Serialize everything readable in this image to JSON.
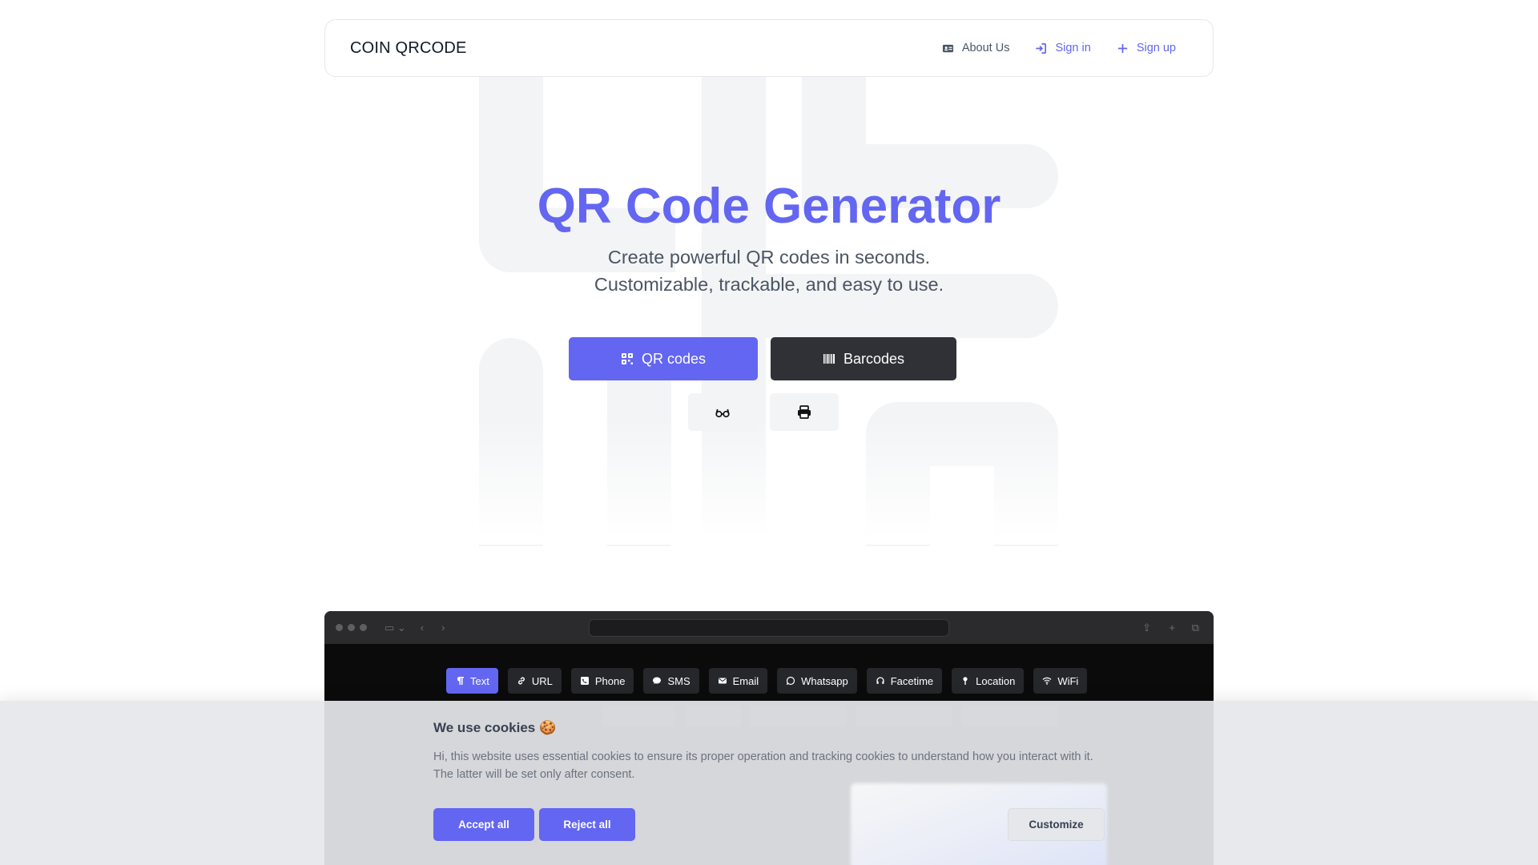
{
  "nav": {
    "brand": "COIN QRCODE",
    "about": "About Us",
    "signin": "Sign in",
    "signup": "Sign up"
  },
  "hero": {
    "title": "QR Code Generator",
    "subtitle_line1": "Create powerful QR codes in seconds.",
    "subtitle_line2": "Customizable, trackable, and easy to use.",
    "btn_qr": "QR codes",
    "btn_barcodes": "Barcodes",
    "icon_btn_1": "glasses-icon",
    "icon_btn_2": "print-icon"
  },
  "mockup": {
    "tabs": [
      "Text",
      "URL",
      "Phone",
      "SMS",
      "Email",
      "Whatsapp",
      "Facetime",
      "Location",
      "WiFi"
    ],
    "active_tab": "Text"
  },
  "cookie": {
    "title": "We use cookies 🍪",
    "text": "Hi, this website uses essential cookies to ensure its proper operation and tracking cookies to understand how you interact with it. The latter will be set only after consent.",
    "accept": "Accept all",
    "reject": "Reject all",
    "customize": "Customize"
  },
  "colors": {
    "accent": "#6366f1",
    "dark_button": "#2f3136",
    "background": "#ffffff"
  }
}
